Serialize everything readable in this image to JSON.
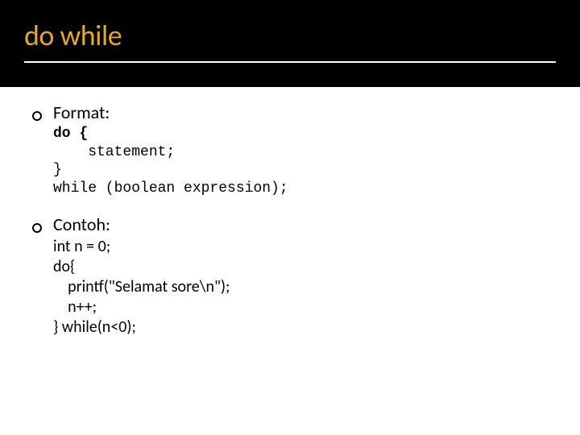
{
  "header": {
    "title": "do while"
  },
  "sections": {
    "format": {
      "label": "Format:",
      "code_l1": "do {",
      "code_l2": "    statement;",
      "code_l3": "}",
      "code_l4": "while (boolean expression);"
    },
    "contoh": {
      "label": "Contoh:",
      "code_l1": "int n = 0;",
      "code_l2": "do{",
      "code_l3": "    printf(\"Selamat sore\\n\");",
      "code_l4": "    n++;",
      "code_l5": "} while(n<0);"
    }
  }
}
